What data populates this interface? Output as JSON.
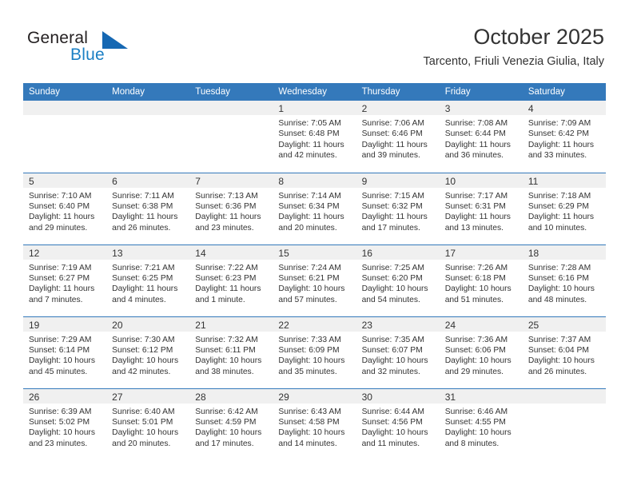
{
  "brand": {
    "name_part1": "General",
    "name_part2": "Blue",
    "accent_color": "#1668b3",
    "logo_icon": "triangle-flag-icon"
  },
  "header": {
    "month_title": "October 2025",
    "location": "Tarcento, Friuli Venezia Giulia, Italy"
  },
  "calendar": {
    "header_color": "#3479bb",
    "daynum_bg": "#f0f0f0",
    "weekdays": [
      "Sunday",
      "Monday",
      "Tuesday",
      "Wednesday",
      "Thursday",
      "Friday",
      "Saturday"
    ],
    "weeks": [
      [
        {
          "day": "",
          "blank": true
        },
        {
          "day": "",
          "blank": true
        },
        {
          "day": "",
          "blank": true
        },
        {
          "day": "1",
          "sunrise": "Sunrise: 7:05 AM",
          "sunset": "Sunset: 6:48 PM",
          "daylight1": "Daylight: 11 hours",
          "daylight2": "and 42 minutes."
        },
        {
          "day": "2",
          "sunrise": "Sunrise: 7:06 AM",
          "sunset": "Sunset: 6:46 PM",
          "daylight1": "Daylight: 11 hours",
          "daylight2": "and 39 minutes."
        },
        {
          "day": "3",
          "sunrise": "Sunrise: 7:08 AM",
          "sunset": "Sunset: 6:44 PM",
          "daylight1": "Daylight: 11 hours",
          "daylight2": "and 36 minutes."
        },
        {
          "day": "4",
          "sunrise": "Sunrise: 7:09 AM",
          "sunset": "Sunset: 6:42 PM",
          "daylight1": "Daylight: 11 hours",
          "daylight2": "and 33 minutes."
        }
      ],
      [
        {
          "day": "5",
          "sunrise": "Sunrise: 7:10 AM",
          "sunset": "Sunset: 6:40 PM",
          "daylight1": "Daylight: 11 hours",
          "daylight2": "and 29 minutes."
        },
        {
          "day": "6",
          "sunrise": "Sunrise: 7:11 AM",
          "sunset": "Sunset: 6:38 PM",
          "daylight1": "Daylight: 11 hours",
          "daylight2": "and 26 minutes."
        },
        {
          "day": "7",
          "sunrise": "Sunrise: 7:13 AM",
          "sunset": "Sunset: 6:36 PM",
          "daylight1": "Daylight: 11 hours",
          "daylight2": "and 23 minutes."
        },
        {
          "day": "8",
          "sunrise": "Sunrise: 7:14 AM",
          "sunset": "Sunset: 6:34 PM",
          "daylight1": "Daylight: 11 hours",
          "daylight2": "and 20 minutes."
        },
        {
          "day": "9",
          "sunrise": "Sunrise: 7:15 AM",
          "sunset": "Sunset: 6:32 PM",
          "daylight1": "Daylight: 11 hours",
          "daylight2": "and 17 minutes."
        },
        {
          "day": "10",
          "sunrise": "Sunrise: 7:17 AM",
          "sunset": "Sunset: 6:31 PM",
          "daylight1": "Daylight: 11 hours",
          "daylight2": "and 13 minutes."
        },
        {
          "day": "11",
          "sunrise": "Sunrise: 7:18 AM",
          "sunset": "Sunset: 6:29 PM",
          "daylight1": "Daylight: 11 hours",
          "daylight2": "and 10 minutes."
        }
      ],
      [
        {
          "day": "12",
          "sunrise": "Sunrise: 7:19 AM",
          "sunset": "Sunset: 6:27 PM",
          "daylight1": "Daylight: 11 hours",
          "daylight2": "and 7 minutes."
        },
        {
          "day": "13",
          "sunrise": "Sunrise: 7:21 AM",
          "sunset": "Sunset: 6:25 PM",
          "daylight1": "Daylight: 11 hours",
          "daylight2": "and 4 minutes."
        },
        {
          "day": "14",
          "sunrise": "Sunrise: 7:22 AM",
          "sunset": "Sunset: 6:23 PM",
          "daylight1": "Daylight: 11 hours",
          "daylight2": "and 1 minute."
        },
        {
          "day": "15",
          "sunrise": "Sunrise: 7:24 AM",
          "sunset": "Sunset: 6:21 PM",
          "daylight1": "Daylight: 10 hours",
          "daylight2": "and 57 minutes."
        },
        {
          "day": "16",
          "sunrise": "Sunrise: 7:25 AM",
          "sunset": "Sunset: 6:20 PM",
          "daylight1": "Daylight: 10 hours",
          "daylight2": "and 54 minutes."
        },
        {
          "day": "17",
          "sunrise": "Sunrise: 7:26 AM",
          "sunset": "Sunset: 6:18 PM",
          "daylight1": "Daylight: 10 hours",
          "daylight2": "and 51 minutes."
        },
        {
          "day": "18",
          "sunrise": "Sunrise: 7:28 AM",
          "sunset": "Sunset: 6:16 PM",
          "daylight1": "Daylight: 10 hours",
          "daylight2": "and 48 minutes."
        }
      ],
      [
        {
          "day": "19",
          "sunrise": "Sunrise: 7:29 AM",
          "sunset": "Sunset: 6:14 PM",
          "daylight1": "Daylight: 10 hours",
          "daylight2": "and 45 minutes."
        },
        {
          "day": "20",
          "sunrise": "Sunrise: 7:30 AM",
          "sunset": "Sunset: 6:12 PM",
          "daylight1": "Daylight: 10 hours",
          "daylight2": "and 42 minutes."
        },
        {
          "day": "21",
          "sunrise": "Sunrise: 7:32 AM",
          "sunset": "Sunset: 6:11 PM",
          "daylight1": "Daylight: 10 hours",
          "daylight2": "and 38 minutes."
        },
        {
          "day": "22",
          "sunrise": "Sunrise: 7:33 AM",
          "sunset": "Sunset: 6:09 PM",
          "daylight1": "Daylight: 10 hours",
          "daylight2": "and 35 minutes."
        },
        {
          "day": "23",
          "sunrise": "Sunrise: 7:35 AM",
          "sunset": "Sunset: 6:07 PM",
          "daylight1": "Daylight: 10 hours",
          "daylight2": "and 32 minutes."
        },
        {
          "day": "24",
          "sunrise": "Sunrise: 7:36 AM",
          "sunset": "Sunset: 6:06 PM",
          "daylight1": "Daylight: 10 hours",
          "daylight2": "and 29 minutes."
        },
        {
          "day": "25",
          "sunrise": "Sunrise: 7:37 AM",
          "sunset": "Sunset: 6:04 PM",
          "daylight1": "Daylight: 10 hours",
          "daylight2": "and 26 minutes."
        }
      ],
      [
        {
          "day": "26",
          "sunrise": "Sunrise: 6:39 AM",
          "sunset": "Sunset: 5:02 PM",
          "daylight1": "Daylight: 10 hours",
          "daylight2": "and 23 minutes."
        },
        {
          "day": "27",
          "sunrise": "Sunrise: 6:40 AM",
          "sunset": "Sunset: 5:01 PM",
          "daylight1": "Daylight: 10 hours",
          "daylight2": "and 20 minutes."
        },
        {
          "day": "28",
          "sunrise": "Sunrise: 6:42 AM",
          "sunset": "Sunset: 4:59 PM",
          "daylight1": "Daylight: 10 hours",
          "daylight2": "and 17 minutes."
        },
        {
          "day": "29",
          "sunrise": "Sunrise: 6:43 AM",
          "sunset": "Sunset: 4:58 PM",
          "daylight1": "Daylight: 10 hours",
          "daylight2": "and 14 minutes."
        },
        {
          "day": "30",
          "sunrise": "Sunrise: 6:44 AM",
          "sunset": "Sunset: 4:56 PM",
          "daylight1": "Daylight: 10 hours",
          "daylight2": "and 11 minutes."
        },
        {
          "day": "31",
          "sunrise": "Sunrise: 6:46 AM",
          "sunset": "Sunset: 4:55 PM",
          "daylight1": "Daylight: 10 hours",
          "daylight2": "and 8 minutes."
        },
        {
          "day": "",
          "blank": true
        }
      ]
    ]
  }
}
